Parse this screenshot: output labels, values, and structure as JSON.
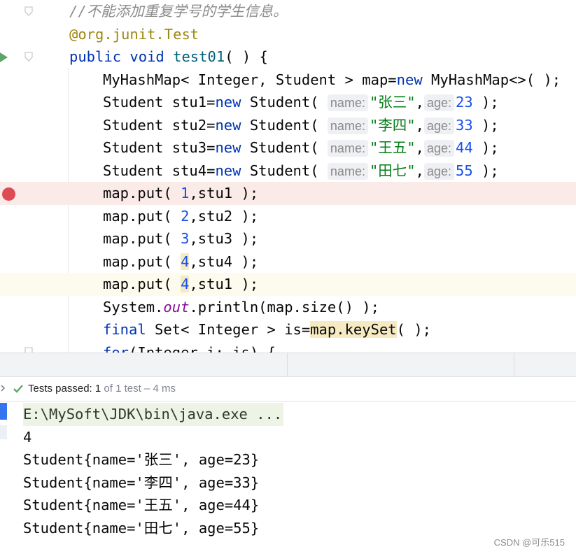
{
  "editor": {
    "comment": "//不能添加重复学号的学生信息。",
    "annotation_prefix": "@org.junit.",
    "annotation_name": "Test",
    "method": {
      "kw1": "public",
      "kw2": "void",
      "name": "test01",
      "rest": "( ) {"
    },
    "map_decl": {
      "a": "MyHashMap< Integer, Student > map=",
      "kw": "new",
      "b": " MyHashMap<>( );"
    },
    "students": [
      {
        "var": "stu1",
        "name_hint": "name:",
        "name": "\"张三\"",
        "age_hint": "age:",
        "age": "23"
      },
      {
        "var": "stu2",
        "name_hint": "name:",
        "name": "\"李四\"",
        "age_hint": "age:",
        "age": "33"
      },
      {
        "var": "stu3",
        "name_hint": "name:",
        "name": "\"王五\"",
        "age_hint": "age:",
        "age": "44"
      },
      {
        "var": "stu4",
        "name_hint": "name:",
        "name": "\"田七\"",
        "age_hint": "age:",
        "age": "55"
      }
    ],
    "student_tokens": {
      "prefix": "Student ",
      "kw": "new",
      "ctor": " Student( ",
      "sep": ",",
      "end": " );"
    },
    "puts": [
      {
        "key": "1",
        "val": ",stu1 );"
      },
      {
        "key": "2",
        "val": ",stu2 );"
      },
      {
        "key": "3",
        "val": ",stu3 );"
      },
      {
        "key": "4",
        "val": ",stu4 );"
      },
      {
        "key": "4",
        "val": ",stu1 );"
      }
    ],
    "put_prefix": "map.put( ",
    "println": {
      "a": "System.",
      "out": "out",
      "b": ".println(map.size() );"
    },
    "keyset": {
      "kw": "final",
      "a": " Set< Integer > is=",
      "hl": "map.keySet",
      "b": "( );"
    },
    "for_line": {
      "kw": "for",
      "rest": "(Integer i: is) {"
    }
  },
  "test_status": {
    "label": "Tests passed:",
    "passed": "1",
    "rest": " of 1 test – 4 ms"
  },
  "console": {
    "command": "E:\\MySoft\\JDK\\bin\\java.exe ...",
    "lines": [
      "4",
      "Student{name='张三', age=23}",
      "Student{name='李四', age=33}",
      "Student{name='王五', age=44}",
      "Student{name='田七', age=55}"
    ]
  },
  "watermark": "CSDN @可乐515",
  "colors": {
    "keyword": "#0033b3",
    "method": "#00627a",
    "number": "#1750eb",
    "string": "#067d17",
    "annotation": "#9e880d",
    "breakpoint": "#db4c53",
    "pass": "#5fa56a"
  },
  "icons": [
    "run-test-icon",
    "fold-icon",
    "breakpoint-icon",
    "check-icon",
    "chevron-right-icon"
  ]
}
